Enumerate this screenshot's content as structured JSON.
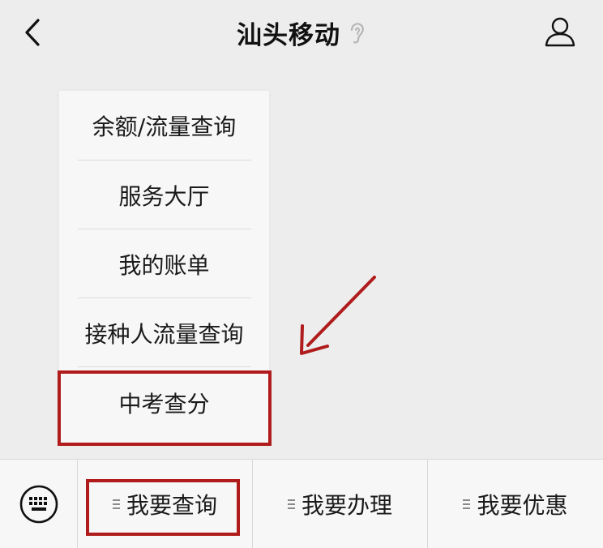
{
  "header": {
    "title": "汕头移动",
    "back_icon": "chevron-left-icon",
    "ear_icon": "ear-icon",
    "profile_icon": "user-profile-icon"
  },
  "popup_menu": {
    "items": [
      {
        "label": "余额/流量查询"
      },
      {
        "label": "服务大厅"
      },
      {
        "label": "我的账单"
      },
      {
        "label": "接种人流量查询"
      },
      {
        "label": "中考查分"
      }
    ]
  },
  "bottom_bar": {
    "keyboard_icon": "keyboard-icon",
    "tabs": [
      {
        "label": "我要查询",
        "icon": "menu-lines-icon"
      },
      {
        "label": "我要办理",
        "icon": "menu-lines-icon"
      },
      {
        "label": "我要优惠",
        "icon": "menu-lines-icon"
      }
    ]
  },
  "annotation": {
    "color": "#b01c1c",
    "arrow_icon": "pointer-arrow-icon"
  }
}
